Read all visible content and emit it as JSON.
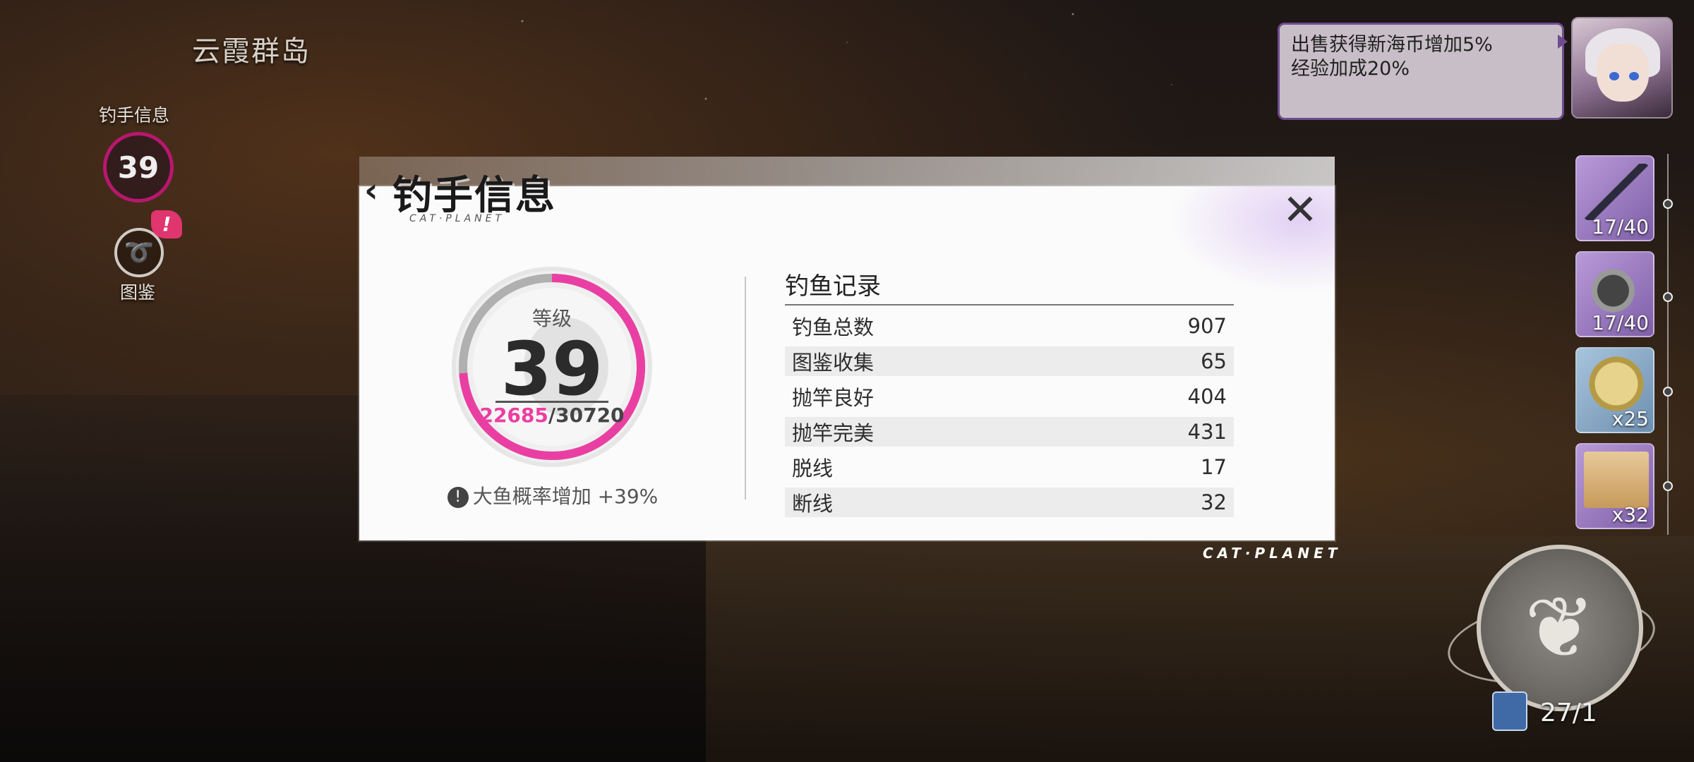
{
  "location": "云霞群岛",
  "side": {
    "angler_label": "钓手信息",
    "angler_level": "39",
    "alert": "!",
    "atlas_label": "图鉴"
  },
  "buff": {
    "line1": "出售获得新海币增加5%",
    "line2": "经验加成20%"
  },
  "inventory": [
    {
      "count": "17/40",
      "icon": "fishing-rod-icon"
    },
    {
      "count": "17/40",
      "icon": "fishing-reel-icon"
    },
    {
      "count": "x25",
      "icon": "fish-coin-icon"
    },
    {
      "count": "x32",
      "icon": "bait-bag-icon"
    }
  ],
  "bait_count": "27/1",
  "brand": "CAT·PLANET",
  "modal": {
    "title": "钓手信息",
    "subtitle": "CAT·PLANET",
    "level_label": "等级",
    "level": "39",
    "exp_current": "22685",
    "exp_total": "/30720",
    "exp_progress": 0.7385,
    "bonus": "大鱼概率增加 +39%",
    "records_title": "钓鱼记录",
    "records": [
      {
        "label": "钓鱼总数",
        "value": "907"
      },
      {
        "label": "图鉴收集",
        "value": "65"
      },
      {
        "label": "抛竿良好",
        "value": "404"
      },
      {
        "label": "抛竿完美",
        "value": "431"
      },
      {
        "label": "脱线",
        "value": "17"
      },
      {
        "label": "断线",
        "value": "32"
      }
    ]
  },
  "colors": {
    "accent": "#ea3fa2",
    "ring_bg": "#b0b0b0"
  }
}
